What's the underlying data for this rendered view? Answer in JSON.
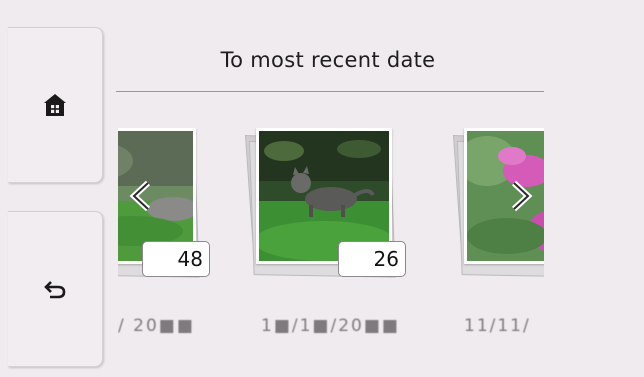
{
  "sidebar": {
    "home_icon": "home-icon",
    "back_icon": "back-arrow-icon"
  },
  "header": {
    "title": "To most recent date"
  },
  "photos": [
    {
      "count": "48",
      "date": "/ 20■■",
      "scene": "grass-cat-partial"
    },
    {
      "count": "26",
      "date": "1■/1■/20■■",
      "scene": "cat-on-grass"
    },
    {
      "count": "",
      "date": "11/11/",
      "scene": "pink-flower"
    }
  ],
  "nav": {
    "prev_icon": "chevron-left-icon",
    "next_icon": "chevron-right-icon"
  },
  "colors": {
    "background": "#efebef",
    "grass": "#3f8a35",
    "flower": "#d45bb8"
  }
}
